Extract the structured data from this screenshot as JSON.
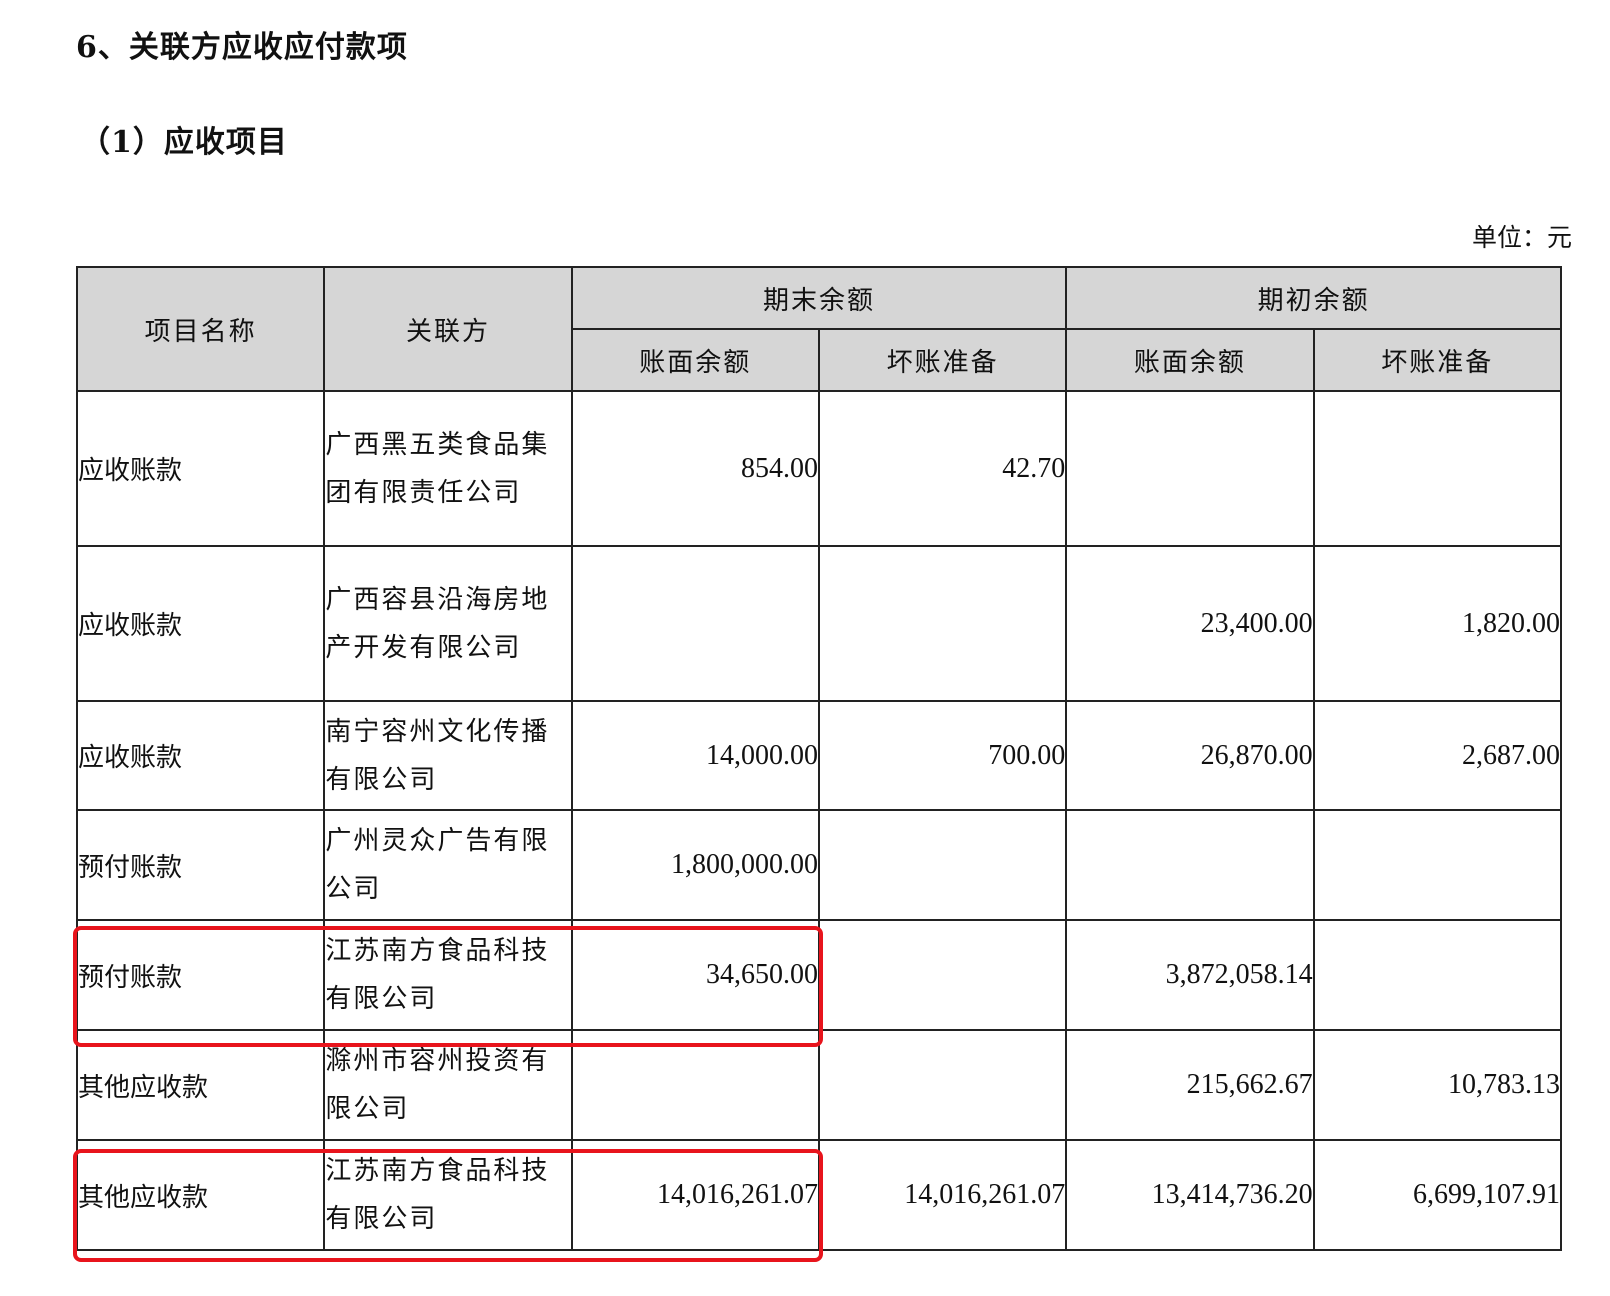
{
  "title": "6、关联方应收应付款项",
  "subtitle": "（1）应收项目",
  "unit": "单位：元",
  "table": {
    "headers": {
      "item": "项目名称",
      "party": "关联方",
      "end_group": "期末余额",
      "begin_group": "期初余额",
      "end_book": "账面余额",
      "end_bad": "坏账准备",
      "begin_book": "账面余额",
      "begin_bad": "坏账准备"
    },
    "rows": [
      {
        "item": "应收账款",
        "party": "广西黑五类食品集团有限责任公司",
        "end_book": "854.00",
        "end_bad": "42.70",
        "begin_book": "",
        "begin_bad": ""
      },
      {
        "item": "应收账款",
        "party": "广西容县沿海房地产开发有限公司",
        "end_book": "",
        "end_bad": "",
        "begin_book": "23,400.00",
        "begin_bad": "1,820.00"
      },
      {
        "item": "应收账款",
        "party": "南宁容州文化传播有限公司",
        "end_book": "14,000.00",
        "end_bad": "700.00",
        "begin_book": "26,870.00",
        "begin_bad": "2,687.00"
      },
      {
        "item": "预付账款",
        "party": "广州灵众广告有限公司",
        "end_book": "1,800,000.00",
        "end_bad": "",
        "begin_book": "",
        "begin_bad": ""
      },
      {
        "item": "预付账款",
        "party": "江苏南方食品科技有限公司",
        "end_book": "34,650.00",
        "end_bad": "",
        "begin_book": "3,872,058.14",
        "begin_bad": ""
      },
      {
        "item": "其他应收款",
        "party": "滁州市容州投资有限公司",
        "end_book": "",
        "end_bad": "",
        "begin_book": "215,662.67",
        "begin_bad": "10,783.13"
      },
      {
        "item": "其他应收款",
        "party": "江苏南方食品科技有限公司",
        "end_book": "14,016,261.07",
        "end_bad": "14,016,261.07",
        "begin_book": "13,414,736.20",
        "begin_bad": "6,699,107.91"
      }
    ]
  },
  "highlight_color": "#e8141c"
}
